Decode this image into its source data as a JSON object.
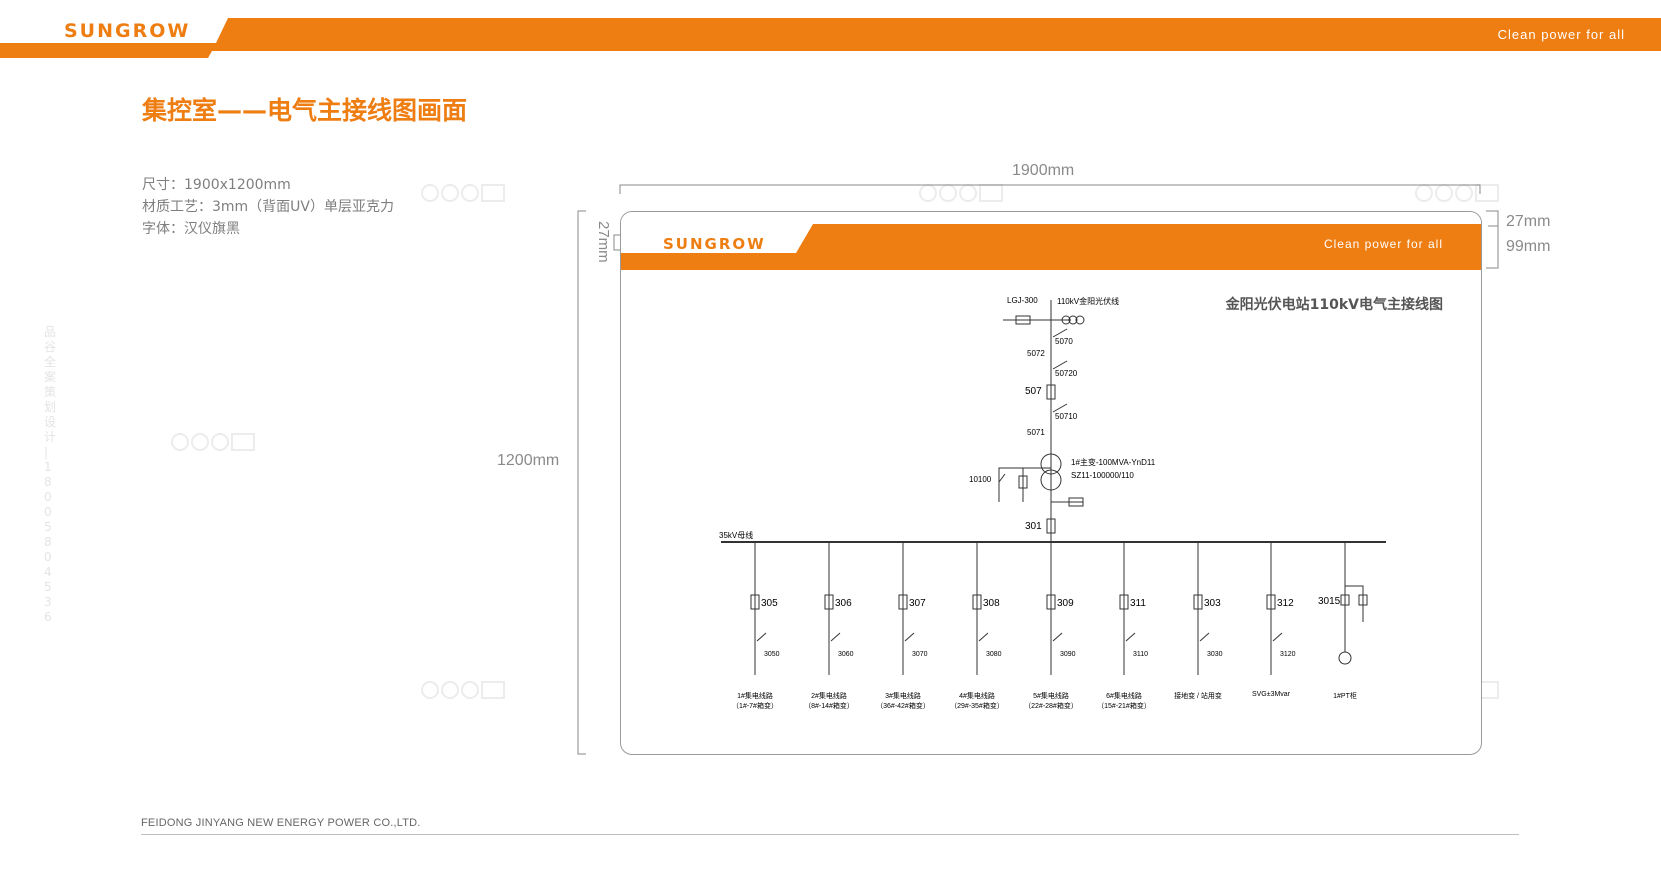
{
  "header": {
    "logo_text": "SUNGROW",
    "slogan": "Clean power for all",
    "color": "#ee7d12"
  },
  "page_title": "集控室——电气主接线图画面",
  "specs": [
    "尺寸：1900x1200mm",
    "材质工艺：3mm（背面UV）单层亚克力",
    "字体：汉仪旗黑"
  ],
  "dimensions": {
    "width": "1900mm",
    "height": "1200mm",
    "bar_thickness": "27mm",
    "bar_height": "99mm",
    "bar_thickness_vertical": "27mm"
  },
  "panel": {
    "logo_text": "SUNGROW",
    "slogan": "Clean power for all",
    "title": "金阳光伏电站110kV电气主接线图"
  },
  "diagram": {
    "line_label": "LGJ-300",
    "line_name": "110kV金阳光伏线",
    "switches": {
      "s5070": "5070",
      "s5072": "5072",
      "s50720": "50720",
      "breaker507": "507",
      "s50710": "50710",
      "s5071": "5071",
      "s10100": "10100",
      "breaker301": "301"
    },
    "transformer_line1": "1#主变-100MVA-YnD11",
    "transformer_line2": "SZ11-100000/110",
    "bus_label": "35kV母线",
    "feeders": [
      {
        "breaker": "305",
        "switch": "3050",
        "name1": "1#集电线路",
        "name2": "（1#-7#箱变）"
      },
      {
        "breaker": "306",
        "switch": "3060",
        "name1": "2#集电线路",
        "name2": "（8#-14#箱变）"
      },
      {
        "breaker": "307",
        "switch": "3070",
        "name1": "3#集电线路",
        "name2": "（36#-42#箱变）"
      },
      {
        "breaker": "308",
        "switch": "3080",
        "name1": "4#集电线路",
        "name2": "（29#-35#箱变）"
      },
      {
        "breaker": "309",
        "switch": "3090",
        "name1": "5#集电线路",
        "name2": "（22#-28#箱变）"
      },
      {
        "breaker": "311",
        "switch": "3110",
        "name1": "6#集电线路",
        "name2": "（15#-21#箱变）"
      },
      {
        "breaker": "303",
        "switch": "3030",
        "name1": "接地变 / 站用变",
        "name2": ""
      },
      {
        "breaker": "312",
        "switch": "3120",
        "name1": "SVG±3Mvar",
        "name2": ""
      }
    ],
    "pt": {
      "breaker": "3015",
      "name": "1#PT柜"
    }
  },
  "watermark": {
    "brand": "pigoo",
    "side_text": "品谷全案策划设计 | 180 0580 4536"
  },
  "footer_text": "FEIDONG JINYANG NEW ENERGY POWER CO.,LTD."
}
